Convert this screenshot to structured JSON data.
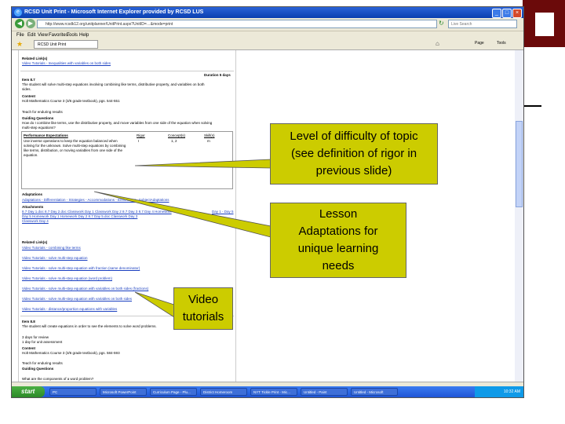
{
  "browser": {
    "title": "RCSD Unit Print - Microsoft Internet Explorer provided by RCSD LUS",
    "url": "http://www.rcsdk12.org/unitplanner/UnitPrint.aspx?UnitID=…&mode=print",
    "search_placeholder": "Live Search",
    "menu": [
      "File",
      "Edit",
      "View",
      "Favorites",
      "Tools",
      "Help"
    ],
    "tab_label": "RCSD Unit Print",
    "tools": [
      "Page",
      "Tools"
    ]
  },
  "page": {
    "related_links_1_heading": "Related Link(s)",
    "related_links_1_item": "Video Tutorials - Inequalities with variables on both sides",
    "duration": "Duration 5 days",
    "item_title": "Item 8.7",
    "item_desc_1": "The student will solve multi-step equations involving combining like terms, distributive property, and variables on both",
    "item_desc_2": "sides.",
    "content_heading": "Content",
    "content_text": "Holt Mathematics Course 3 (3/6 grade textbook), pgs. 544-551",
    "teach_text": "Teach for enduring results",
    "guiding_heading": "Guiding Questions",
    "guiding_text_1": "How do I combine like terms, use the distributive property, and move variables from one side of the equation when solving",
    "guiding_text_2": "multi-step equations?",
    "table_headers": [
      "Performance Expectations",
      "Rigor",
      "Concept(s)",
      "Skill(s)"
    ],
    "table_row": [
      "Use inverse operations to keep the equation balanced when",
      "solving for the unknown. Solve multi-step equations by combining",
      "like terms, distribution, or moving variables from one side of the",
      "equation."
    ],
    "table_rigor": "I",
    "table_concepts": "1, 2",
    "table_skills": "m",
    "adaptations_heading": "Adaptations",
    "adaptations_links": "Adaptations - Differentiation - Strategies - Accommodations - Enrichment - SubjectAdaptations",
    "attachments_heading": "Attachments",
    "attachments_lines": [
      "8.7 Day 1.doc  8.7 Day 2.doc  Classwork Day 1  Classwork Day 2  8.7 Day 3  8.7 Day 4  Homework",
      "Day 5  Homework Day 1  Homework Day 2  8.7 Day 5.doc  Classwork Day 3",
      "Classwork Day 4"
    ],
    "attachments_right": "Day 1 - Day 5",
    "related_links_2_heading": "Related Link(s)",
    "video_links": [
      "Video Tutorials - combining like terms",
      "Video Tutorials - solve multi-step equation",
      "Video Tutorials - solve multi-step equation with fraction (same denominator)",
      "Video Tutorials - solve multi-step equation (word problem)",
      "Video Tutorials - solve multi-step equation with variables on both sides (fractions)",
      "Video Tutorials - solve multi-step equation with variables on both sides",
      "Video Tutorials - distance/proportion equations with variables"
    ],
    "item2_title": "Item 8.8",
    "item2_desc": "The student will create equations in order to see the elements to solve word problems.",
    "item2_lines": [
      "3 days for review",
      "1 day for unit assessment"
    ],
    "content2_heading": "Content",
    "content2_text": "Holt Mathematics Course 3 (3/6 grade textbook), pgs. 584-593",
    "teach2_text": "Teach for enduring results",
    "guiding2_heading": "Guiding Questions",
    "guiding2_text": "What are the components of a word problem?"
  },
  "taskbar": {
    "start_label": "start",
    "tasks": [
      "PC",
      "Microsoft PowerPoint",
      "Curriculum Page - Plu...",
      "District Homeroom",
      "NYT Tickle Print - Mic...",
      "Untitled - Paint",
      "Untitled - Microsoft"
    ],
    "clock": "10:32 AM"
  },
  "callouts": {
    "rigor": [
      "Level of difficulty of topic",
      "(see definition of rigor in",
      "previous slide)"
    ],
    "adaptations": [
      "Lesson",
      "Adaptations for",
      "unique learning",
      "needs"
    ],
    "video": [
      "Video",
      "tutorials"
    ]
  },
  "colors": {
    "callout_fill": "#cccc00",
    "deco_dark": "#6b0a0a",
    "deco_light": "#ffffff"
  }
}
